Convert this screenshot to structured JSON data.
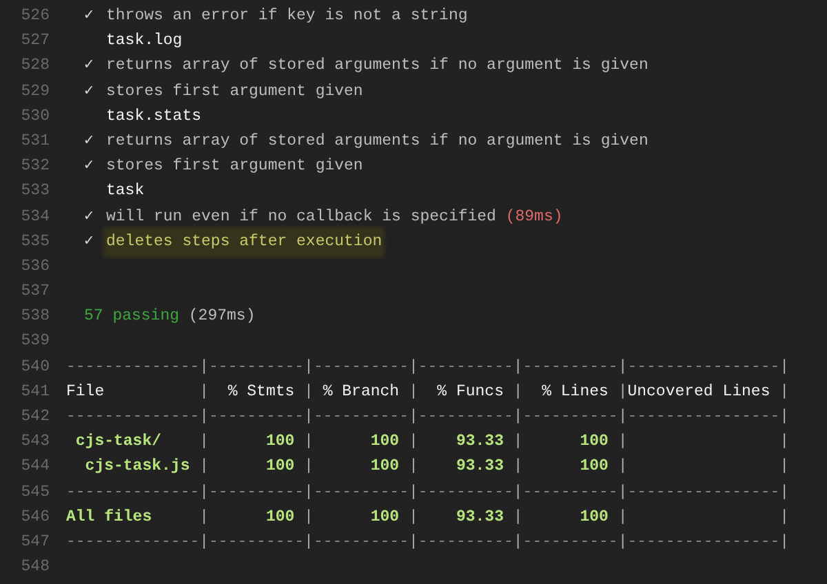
{
  "lines": [
    {
      "number": "526",
      "kind": "test",
      "mark": "✓",
      "text": "throws an error if key is not a string",
      "highlighted": false
    },
    {
      "number": "527",
      "kind": "suite",
      "text": "task.log"
    },
    {
      "number": "528",
      "kind": "test",
      "mark": "✓",
      "text": "returns array of stored arguments if no argument is given",
      "highlighted": false
    },
    {
      "number": "529",
      "kind": "test",
      "mark": "✓",
      "text": "stores first argument given",
      "highlighted": false
    },
    {
      "number": "530",
      "kind": "suite",
      "text": "task.stats"
    },
    {
      "number": "531",
      "kind": "test",
      "mark": "✓",
      "text": "returns array of stored arguments if no argument is given",
      "highlighted": false
    },
    {
      "number": "532",
      "kind": "test",
      "mark": "✓",
      "text": "stores first argument given",
      "highlighted": false
    },
    {
      "number": "533",
      "kind": "suite",
      "text": "task"
    },
    {
      "number": "534",
      "kind": "test",
      "mark": "✓",
      "text": "will run even if no callback is specified",
      "duration": "(89ms)",
      "highlighted": false
    },
    {
      "number": "535",
      "kind": "test",
      "mark": "✓",
      "text": "deletes steps after execution",
      "highlighted": true
    },
    {
      "number": "536",
      "kind": "blank"
    },
    {
      "number": "537",
      "kind": "blank"
    },
    {
      "number": "538",
      "kind": "summary",
      "text": "57 passing",
      "duration": "(297ms)"
    },
    {
      "number": "539",
      "kind": "blank"
    },
    {
      "number": "540",
      "kind": "rule",
      "cells": [
        "--------------",
        "----------",
        "----------",
        "----------",
        "----------",
        "----------------"
      ]
    },
    {
      "number": "541",
      "kind": "header",
      "cells": [
        "File          ",
        "  % Stmts ",
        " % Branch ",
        "  % Funcs ",
        "  % Lines ",
        "Uncovered Lines "
      ]
    },
    {
      "number": "542",
      "kind": "rule",
      "cells": [
        "--------------",
        "----------",
        "----------",
        "----------",
        "----------",
        "----------------"
      ]
    },
    {
      "number": "543",
      "kind": "row",
      "cells": [
        " cjs-task/    ",
        "      100 ",
        "      100 ",
        "    93.33 ",
        "      100 ",
        "                "
      ]
    },
    {
      "number": "544",
      "kind": "row",
      "cells": [
        "  cjs-task.js ",
        "      100 ",
        "      100 ",
        "    93.33 ",
        "      100 ",
        "                "
      ]
    },
    {
      "number": "545",
      "kind": "rule",
      "cells": [
        "--------------",
        "----------",
        "----------",
        "----------",
        "----------",
        "----------------"
      ]
    },
    {
      "number": "546",
      "kind": "row",
      "cells": [
        "All files     ",
        "      100 ",
        "      100 ",
        "    93.33 ",
        "      100 ",
        "                "
      ]
    },
    {
      "number": "547",
      "kind": "rule",
      "cells": [
        "--------------",
        "----------",
        "----------",
        "----------",
        "----------",
        "----------------"
      ]
    },
    {
      "number": "548",
      "kind": "blank"
    }
  ],
  "table": {
    "separator": "|"
  }
}
